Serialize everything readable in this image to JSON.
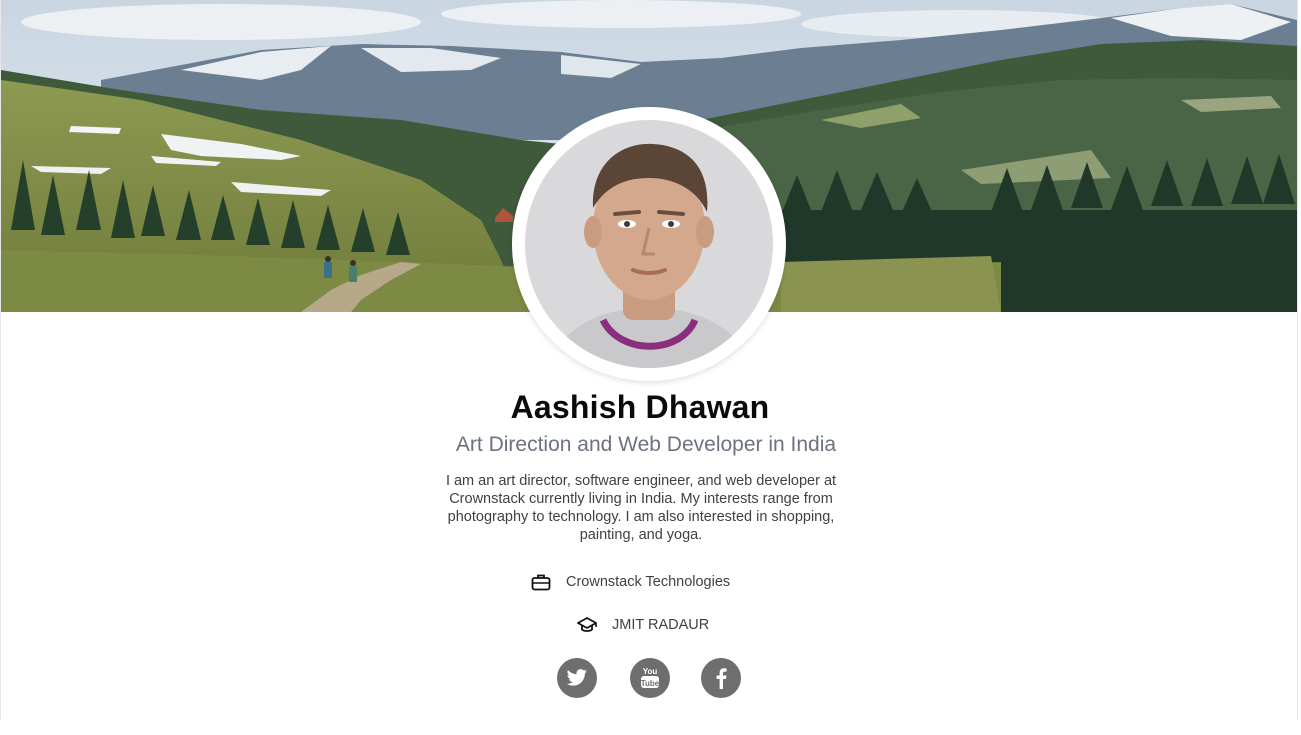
{
  "profile": {
    "name": "Aashish Dhawan",
    "title": "Art Direction and Web Developer in India",
    "bio": "I am an art director, software engineer, and web developer at Crownstack currently living in India. My interests range from photography to technology. I am also interested in shopping, painting, and yoga.",
    "work": "Crownstack Technologies",
    "education": "JMIT RADAUR"
  },
  "icons": {
    "work": "briefcase-icon",
    "education": "graduation-cap-icon",
    "social": [
      "twitter-icon",
      "youtube-icon",
      "facebook-icon"
    ]
  },
  "colors": {
    "social_bg": "#6e6e6e",
    "name": "#0b0b0b",
    "title": "#6b7280",
    "body": "#3f3f46"
  }
}
